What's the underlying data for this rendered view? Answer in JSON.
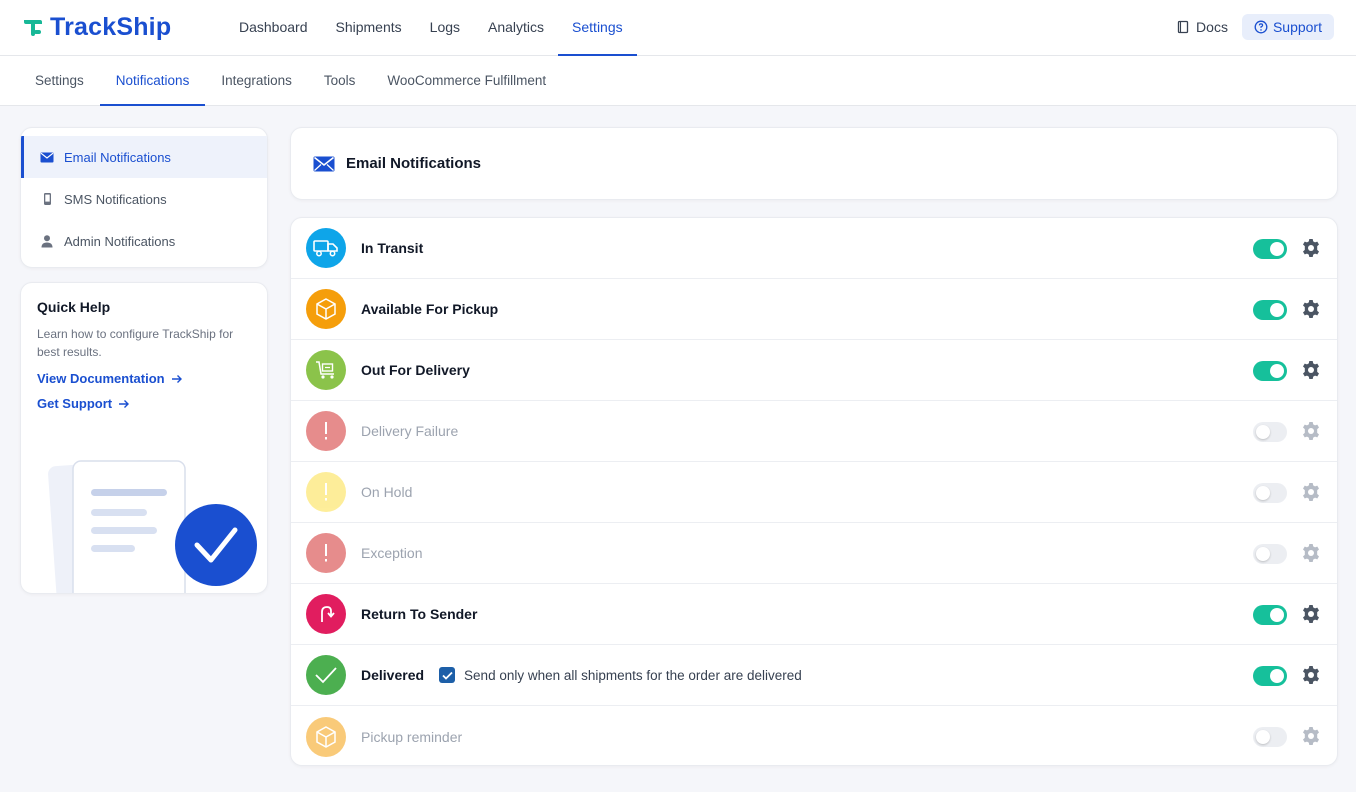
{
  "brand": {
    "name": "TrackShip"
  },
  "topnav": {
    "items": [
      "Dashboard",
      "Shipments",
      "Logs",
      "Analytics",
      "Settings"
    ],
    "active_index": 4,
    "docs": "Docs",
    "support": "Support"
  },
  "subtabs": {
    "items": [
      "Settings",
      "Notifications",
      "Integrations",
      "Tools",
      "WooCommerce Fulfillment"
    ],
    "active_index": 1
  },
  "sidebar": {
    "items": [
      {
        "label": "Email Notifications",
        "icon": "envelope-icon",
        "active": true
      },
      {
        "label": "SMS Notifications",
        "icon": "phone-icon",
        "active": false
      },
      {
        "label": "Admin Notifications",
        "icon": "user-icon",
        "active": false
      }
    ]
  },
  "quick_help": {
    "title": "Quick Help",
    "text": "Learn how to configure TrackShip for best results.",
    "links": [
      "View Documentation",
      "Get Support"
    ]
  },
  "main": {
    "title": "Email Notifications",
    "rows": [
      {
        "label": "In Transit",
        "icon": "truck-icon",
        "color": "#0ea5e9",
        "enabled": true
      },
      {
        "label": "Available For Pickup",
        "icon": "box-icon",
        "color": "#f59e0b",
        "enabled": true
      },
      {
        "label": "Out For Delivery",
        "icon": "cart-icon",
        "color": "#8bc34a",
        "enabled": true
      },
      {
        "label": "Delivery Failure",
        "icon": "exclamation-icon",
        "color": "#d32f2f",
        "enabled": false
      },
      {
        "label": "On Hold",
        "icon": "exclamation-icon",
        "color": "#fde047",
        "enabled": false
      },
      {
        "label": "Exception",
        "icon": "exclamation-icon",
        "color": "#d32f2f",
        "enabled": false
      },
      {
        "label": "Return To Sender",
        "icon": "return-arrow-icon",
        "color": "#e11d5f",
        "enabled": true
      },
      {
        "label": "Delivered",
        "icon": "checkmark-icon",
        "color": "#4caf50",
        "enabled": true,
        "checkbox": {
          "label": "Send only when all shipments for the order are delivered",
          "checked": true
        }
      },
      {
        "label": "Pickup reminder",
        "icon": "box-icon",
        "color": "#f59e0b",
        "enabled": false
      }
    ]
  }
}
